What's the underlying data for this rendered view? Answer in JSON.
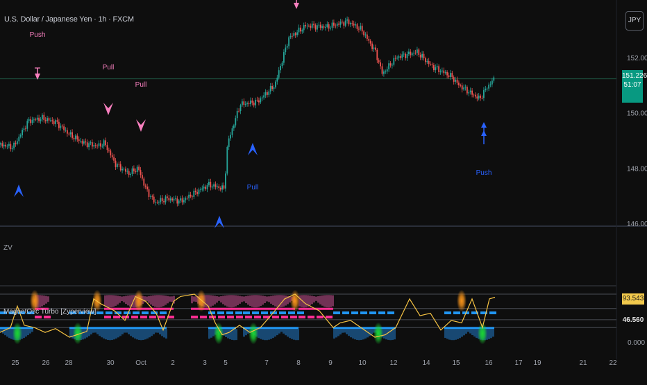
{
  "header": {
    "title": "U.S. Dollar / Japanese Yen · 1h · FXCM",
    "currency_button": "JPY",
    "indicator_pane_label": "ZV",
    "indicator_name": "MagnetOsc Turbo [Zyperview]"
  },
  "price_tag": {
    "price": "151.226",
    "countdown": "51:07",
    "color": "#089981"
  },
  "osc_tags": [
    {
      "value": "93.543",
      "bg": "#f2c94c",
      "fg": "#1a1a1a"
    },
    {
      "value": "46.560",
      "bg": "#0e0e0e",
      "fg": "#e6e6e6"
    }
  ],
  "colors": {
    "up": "#26a69a",
    "down": "#ef5350",
    "push_pull_bear": "#f77fbe",
    "push_pull_bull": "#2962ff",
    "osc_line": "#f6c343",
    "magenta": "#ff2e93",
    "cyan": "#2196f3",
    "orange_glow": "#f7931a",
    "green_glow": "#1bd633"
  },
  "chart_data": [
    {
      "type": "candlestick",
      "title": "U.S. Dollar / Japanese Yen · 1h · FXCM",
      "ylim": [
        146,
        154
      ],
      "y_ticks": [
        "146.000",
        "148.000",
        "150.000",
        "152.000"
      ],
      "x_ticks": [
        "25",
        "26",
        "28",
        "30",
        "Oct",
        "2",
        "3",
        "5",
        "7",
        "8",
        "9",
        "10",
        "12",
        "14",
        "15",
        "16",
        "17",
        "19",
        "21",
        "22"
      ],
      "horizontal_line": 151.226,
      "close_path": [
        [
          0,
          148.85
        ],
        [
          18,
          148.75
        ],
        [
          40,
          149.7
        ],
        [
          60,
          149.8
        ],
        [
          80,
          149.65
        ],
        [
          100,
          149.2
        ],
        [
          120,
          148.9
        ],
        [
          140,
          148.8
        ],
        [
          150,
          148.9
        ],
        [
          165,
          148.15
        ],
        [
          185,
          147.8
        ],
        [
          198,
          148.0
        ],
        [
          210,
          147.2
        ],
        [
          222,
          146.75
        ],
        [
          240,
          146.9
        ],
        [
          260,
          146.8
        ],
        [
          280,
          147.1
        ],
        [
          300,
          147.4
        ],
        [
          322,
          147.25
        ],
        [
          327,
          148.9
        ],
        [
          345,
          150.3
        ],
        [
          370,
          150.4
        ],
        [
          395,
          151.0
        ],
        [
          415,
          152.7
        ],
        [
          440,
          153.15
        ],
        [
          470,
          153.1
        ],
        [
          500,
          153.3
        ],
        [
          520,
          153.0
        ],
        [
          540,
          152.2
        ],
        [
          550,
          151.4
        ],
        [
          570,
          152.0
        ],
        [
          600,
          152.2
        ],
        [
          620,
          151.7
        ],
        [
          650,
          151.3
        ],
        [
          660,
          151.0
        ],
        [
          690,
          150.5
        ],
        [
          700,
          150.9
        ],
        [
          712,
          151.25
        ]
      ],
      "signals": [
        {
          "label": "Push",
          "shape": "arrow",
          "dir": "down",
          "color": "bear",
          "x": 54,
          "y": 112,
          "text_y": 53
        },
        {
          "label": "Pull",
          "shape": "chevron",
          "dir": "down",
          "color": "bear",
          "x": 156,
          "y": 162,
          "text_y": 100
        },
        {
          "label": "Pull",
          "shape": "chevron",
          "dir": "down",
          "color": "bear",
          "x": 203,
          "y": 186,
          "text_y": 125
        },
        {
          "label": "",
          "shape": "arrow",
          "dir": "down",
          "color": "bear",
          "x": 427,
          "y": 10,
          "text_y": 0
        },
        {
          "label": "",
          "shape": "chevron",
          "dir": "up",
          "color": "bull",
          "x": 27,
          "y": 270,
          "text_y": 0
        },
        {
          "label": "",
          "shape": "chevron",
          "dir": "up",
          "color": "bull",
          "x": 316,
          "y": 315,
          "text_y": 0
        },
        {
          "label": "Pull",
          "shape": "chevron",
          "dir": "up",
          "color": "bull",
          "x": 364,
          "y": 210,
          "text_y": 273
        },
        {
          "label": "Push",
          "shape": "arrow",
          "dir": "up",
          "color": "bull",
          "x": 697,
          "y": 190,
          "text_y": 252
        }
      ]
    },
    {
      "type": "line",
      "title": "MagnetOsc Turbo [Zyperview]",
      "ylim": [
        0,
        100
      ],
      "y_ticks": [
        "0.000"
      ],
      "levels": [
        100,
        70,
        46.56,
        30
      ],
      "osc_path": [
        [
          0,
          20
        ],
        [
          15,
          30
        ],
        [
          25,
          75
        ],
        [
          35,
          35
        ],
        [
          50,
          30
        ],
        [
          65,
          20
        ],
        [
          80,
          28
        ],
        [
          100,
          10
        ],
        [
          125,
          22
        ],
        [
          135,
          90
        ],
        [
          145,
          80
        ],
        [
          165,
          65
        ],
        [
          180,
          45
        ],
        [
          195,
          95
        ],
        [
          210,
          85
        ],
        [
          225,
          60
        ],
        [
          235,
          25
        ],
        [
          250,
          85
        ],
        [
          260,
          95
        ],
        [
          280,
          100
        ],
        [
          300,
          75
        ],
        [
          310,
          40
        ],
        [
          320,
          15
        ],
        [
          330,
          20
        ],
        [
          345,
          35
        ],
        [
          360,
          20
        ],
        [
          375,
          30
        ],
        [
          390,
          55
        ],
        [
          410,
          90
        ],
        [
          425,
          100
        ],
        [
          440,
          80
        ],
        [
          460,
          65
        ],
        [
          480,
          30
        ],
        [
          490,
          40
        ],
        [
          505,
          45
        ],
        [
          520,
          30
        ],
        [
          540,
          10
        ],
        [
          555,
          15
        ],
        [
          570,
          30
        ],
        [
          590,
          90
        ],
        [
          605,
          55
        ],
        [
          620,
          60
        ],
        [
          635,
          25
        ],
        [
          650,
          45
        ],
        [
          665,
          40
        ],
        [
          680,
          90
        ],
        [
          695,
          30
        ],
        [
          705,
          90
        ],
        [
          713,
          93.543
        ]
      ],
      "magenta_bars": [
        [
          50,
          70
        ],
        [
          150,
          250
        ],
        [
          275,
          425
        ],
        [
          430,
          480
        ]
      ],
      "cyan_bars": [
        [
          0,
          48
        ],
        [
          100,
          240
        ],
        [
          300,
          340
        ],
        [
          350,
          430
        ],
        [
          480,
          570
        ],
        [
          640,
          712
        ]
      ],
      "orange_peaks": [
        50,
        140,
        200,
        290,
        425,
        665
      ],
      "green_troughs": [
        25,
        112,
        315,
        365,
        545,
        695
      ],
      "readouts": [
        "93.543",
        "46.560"
      ]
    }
  ]
}
